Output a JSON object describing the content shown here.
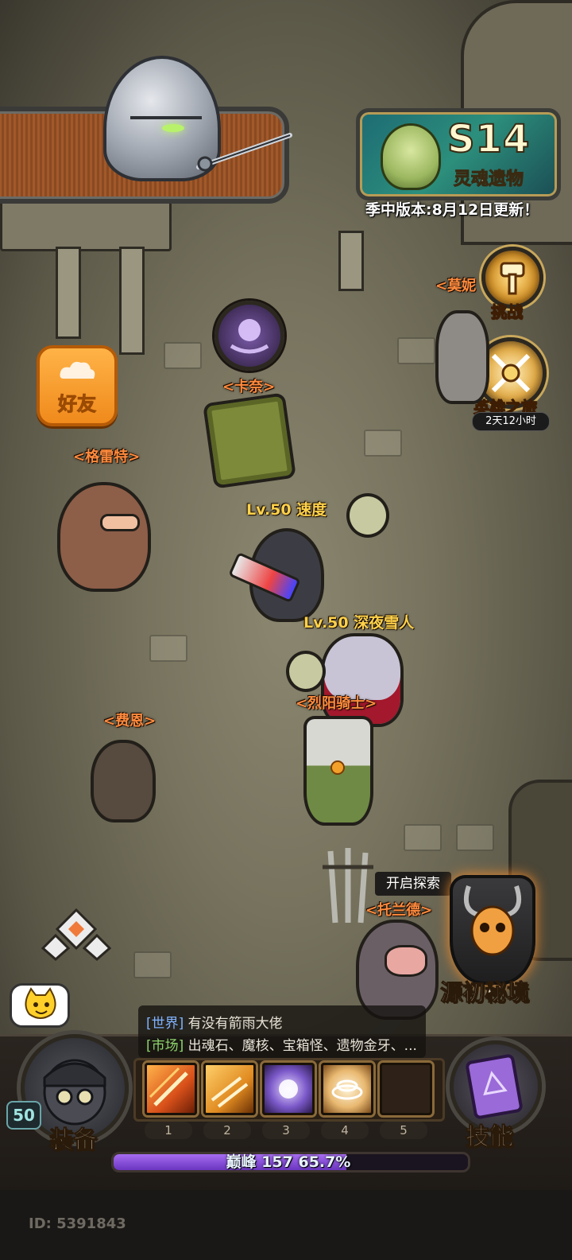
{
  "season": {
    "title": "S14",
    "subtitle": "灵魂遗物",
    "update_note": "季中版本:8月12日更新！"
  },
  "side_menu": {
    "challenge_label": "挑战",
    "journey_label": "英雄之旅",
    "journey_timer": "2天12小时"
  },
  "friends": {
    "label": "好友"
  },
  "npcs": {
    "kana": "<卡奈>",
    "grete": "<格雷特>",
    "monnie": "<莫妮",
    "fane": "<费恩>",
    "sun_knight": "<烈阳骑士>",
    "toland": "<托兰德>"
  },
  "players": {
    "speed_player": "Lv.50 速度",
    "yeti_player": "Lv.50 深夜雪人"
  },
  "dungeon": {
    "explore_hint": "开启探索",
    "label": "源初秘境"
  },
  "chat": {
    "line1_tag": "[世界]",
    "line1_text": " 有没有箭雨大佬",
    "line2_tag": "[市场]",
    "line2_text": " 出魂石、魔核、宝箱怪、遗物金牙、..."
  },
  "hud": {
    "equip_label": "装备",
    "skills_label": "技能",
    "player_level": "50",
    "slot_numbers": [
      "1",
      "2",
      "3",
      "4",
      "5"
    ],
    "xp_label": "巅峰 157",
    "xp_percent_text": "65.7%",
    "xp_progress": 0.657,
    "player_id": "ID: 5391843"
  },
  "colors": {
    "npc_name": "#ff8a3d",
    "player_name": "#ffd24a",
    "xp_fill": "#8a4fe0",
    "friends_button": "#f29a2a"
  },
  "icons": {
    "season_badge": "season-boss-icon",
    "challenge": "hammer-icon",
    "journey": "crossed-swords-icon",
    "friends": "cloud-icon",
    "chat_emote": "cat-face-icon",
    "skills": "spellbook-icon",
    "dungeon": "horned-skull-icon"
  }
}
